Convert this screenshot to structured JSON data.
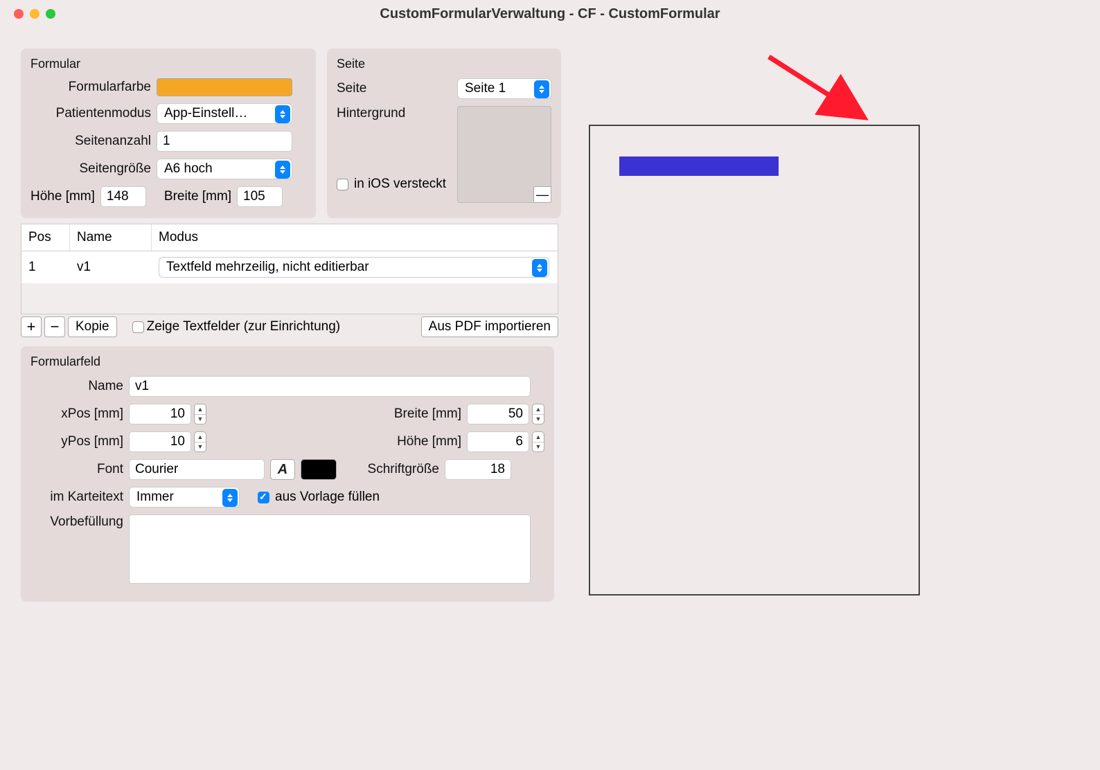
{
  "window": {
    "title": "CustomFormularVerwaltung - CF - CustomFormular"
  },
  "formular": {
    "title": "Formular",
    "color_label": "Formularfarbe",
    "color_value": "#f5a623",
    "patientmode_label": "Patientenmodus",
    "patientmode_value": "App-Einstell…",
    "pagecount_label": "Seitenanzahl",
    "pagecount_value": "1",
    "pagesize_label": "Seitengröße",
    "pagesize_value": "A6 hoch",
    "height_label": "Höhe [mm]",
    "height_value": "148",
    "width_label": "Breite [mm]",
    "width_value": "105"
  },
  "seite": {
    "title": "Seite",
    "page_label": "Seite",
    "page_value": "Seite 1",
    "background_label": "Hintergrund",
    "hidden_label": "in iOS versteckt",
    "minus_label": "—"
  },
  "table": {
    "headers": {
      "pos": "Pos",
      "name": "Name",
      "modus": "Modus"
    },
    "rows": [
      {
        "pos": "1",
        "name": "v1",
        "modus": "Textfeld mehrzeilig, nicht editierbar"
      }
    ]
  },
  "toolbar": {
    "add": "+",
    "remove": "−",
    "copy": "Kopie",
    "show_fields": "Zeige Textfelder (zur Einrichtung)",
    "import_pdf": "Aus PDF importieren"
  },
  "feld": {
    "title": "Formularfeld",
    "name_label": "Name",
    "name_value": "v1",
    "xpos_label": "xPos [mm]",
    "xpos_value": "10",
    "ypos_label": "yPos [mm]",
    "ypos_value": "10",
    "breite_label": "Breite [mm]",
    "breite_value": "50",
    "hoehe_label": "Höhe [mm]",
    "hoehe_value": "6",
    "font_label": "Font",
    "font_value": "Courier",
    "fontpicker_glyph": "A",
    "fontsize_label": "Schriftgröße",
    "fontsize_value": "18",
    "kartei_label": "im Karteitext",
    "kartei_value": "Immer",
    "fill_template_label": "aus Vorlage füllen",
    "prefill_label": "Vorbefüllung"
  }
}
